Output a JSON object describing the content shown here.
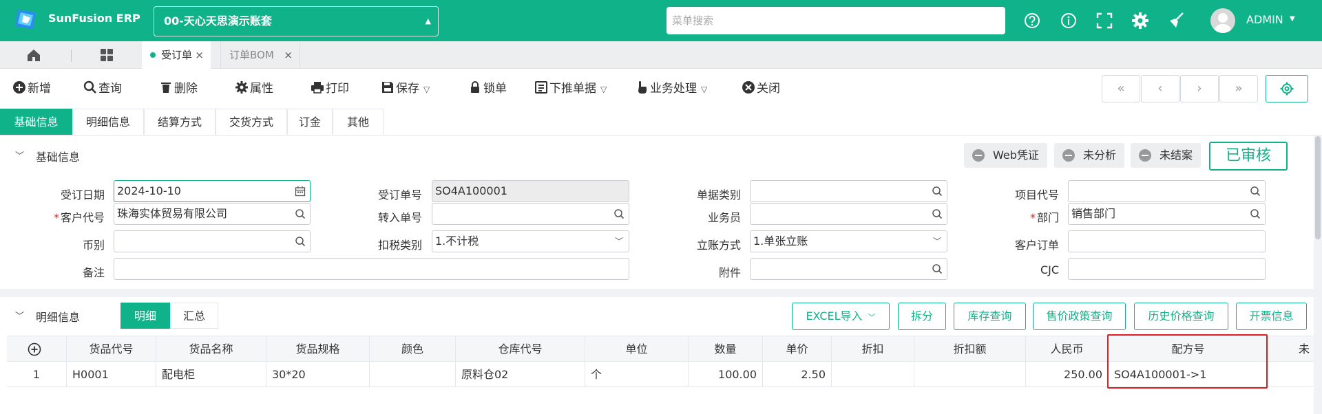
{
  "app": {
    "title": "SunFusion ERP",
    "account": "00-天心天思演示账套",
    "search_placeholder": "菜单搜索",
    "user": "ADMIN",
    "brand_color": "#10b289"
  },
  "top_icons": [
    "help-icon",
    "info-icon",
    "fullscreen-icon",
    "settings-icon",
    "broom-icon"
  ],
  "open_tabs": [
    {
      "label": "受订单",
      "active": true
    },
    {
      "label": "订单BOM",
      "active": false
    }
  ],
  "toolbar": {
    "add": "新增",
    "query": "查询",
    "delete": "删除",
    "properties": "属性",
    "print": "打印",
    "save": "保存",
    "lock": "锁单",
    "push_down": "下推单据",
    "business": "业务处理",
    "close": "关闭",
    "nav": [
      "«",
      "‹",
      "›",
      "»"
    ]
  },
  "section_tabs": [
    "基础信息",
    "明细信息",
    "结算方式",
    "交货方式",
    "订金",
    "其他"
  ],
  "basic_info": {
    "title": "基础信息",
    "status_chips": [
      "Web凭证",
      "未分析",
      "未结案"
    ],
    "approved": "已审核",
    "fields": {
      "order_date": {
        "label": "受订日期",
        "value": "2024-10-10"
      },
      "order_no": {
        "label": "受订单号",
        "value": "SO4A100001"
      },
      "doc_type": {
        "label": "单据类别",
        "value": ""
      },
      "project_code": {
        "label": "项目代号",
        "value": ""
      },
      "customer": {
        "label": "客户代号",
        "value": "珠海实体贸易有限公司",
        "required_mark": "*"
      },
      "transfer_no": {
        "label": "转入单号",
        "value": ""
      },
      "salesperson": {
        "label": "业务员",
        "value": ""
      },
      "department": {
        "label": "部门",
        "value": "销售部门",
        "required_mark": "*"
      },
      "currency": {
        "label": "币别",
        "value": ""
      },
      "tax_type": {
        "label": "扣税类别",
        "value": "1.不计税"
      },
      "account_method": {
        "label": "立账方式",
        "value": "1.单张立账"
      },
      "customer_order": {
        "label": "客户订单",
        "value": ""
      },
      "remark": {
        "label": "备注",
        "value": ""
      },
      "attachment": {
        "label": "附件",
        "value": ""
      },
      "cjc": {
        "label": "CJC",
        "value": ""
      }
    }
  },
  "detail": {
    "title": "明细信息",
    "subtabs": [
      "明细",
      "汇总"
    ],
    "actions": [
      "EXCEL导入",
      "拆分",
      "库存查询",
      "售价政策查询",
      "历史价格查询",
      "开票信息"
    ],
    "columns": [
      "货品代号",
      "货品名称",
      "货品规格",
      "颜色",
      "仓库代号",
      "单位",
      "数量",
      "单价",
      "折扣",
      "折扣额",
      "人民币",
      "配方号",
      "未"
    ],
    "rows": [
      {
        "idx": "1",
        "code": "H0001",
        "name": "配电柜",
        "spec": "30*20",
        "color": "",
        "warehouse": "原料仓02",
        "unit": "个",
        "qty": "100.00",
        "price": "2.50",
        "discount": "",
        "discount_amt": "",
        "rmb": "250.00",
        "formula": "SO4A100001->1"
      }
    ]
  }
}
